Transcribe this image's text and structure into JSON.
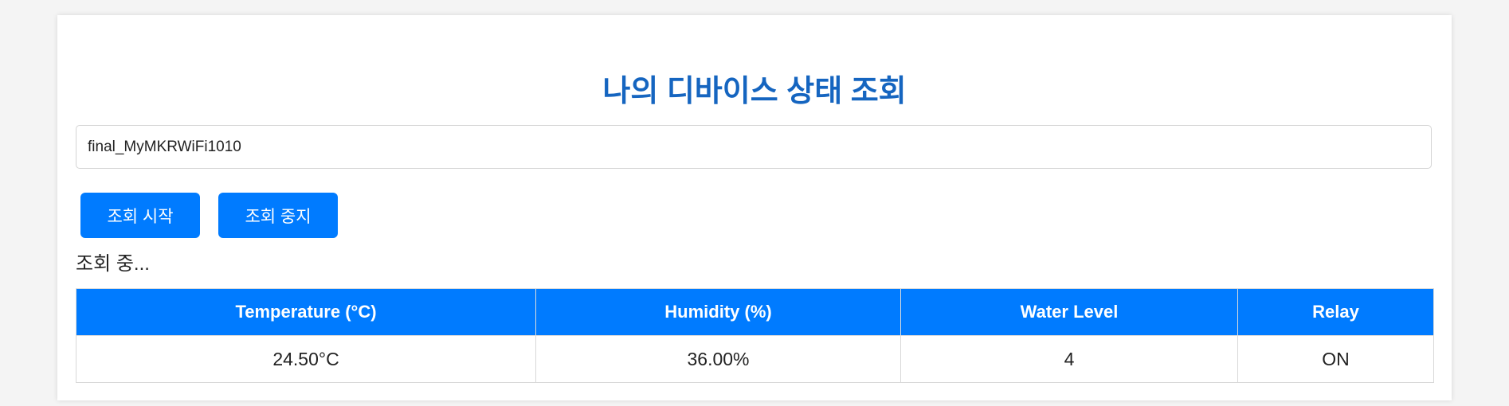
{
  "page": {
    "title": "나의 디바이스 상태 조회"
  },
  "device": {
    "input_value": "final_MyMKRWiFi1010"
  },
  "controls": {
    "start_label": "조회 시작",
    "stop_label": "조회 중지"
  },
  "status": {
    "text": "조회 중..."
  },
  "table": {
    "headers": [
      "Temperature (°C)",
      "Humidity (%)",
      "Water Level",
      "Relay"
    ],
    "rows": [
      [
        "24.50°C",
        "36.00%",
        "4",
        "ON"
      ]
    ]
  },
  "colors": {
    "accent": "#007bff",
    "title": "#1565c0"
  }
}
